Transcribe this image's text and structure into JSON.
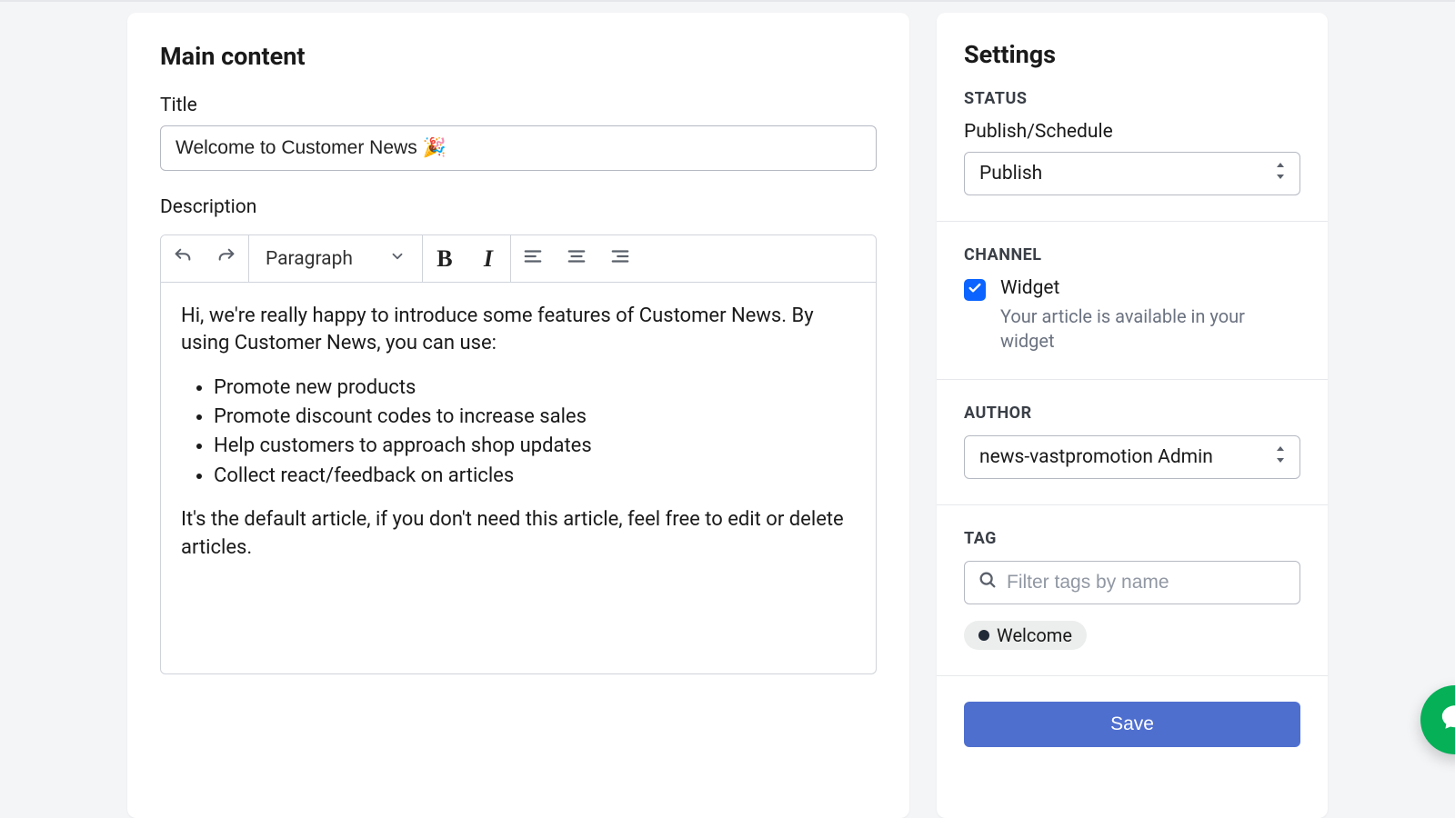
{
  "main": {
    "card_title": "Main content",
    "title_label": "Title",
    "title_value": "Welcome to Customer News 🎉",
    "description_label": "Description",
    "toolbar": {
      "style_label": "Paragraph"
    },
    "content": {
      "intro": "Hi, we're really happy to introduce some features of Customer News. By using Customer News, you can use:",
      "bullets": [
        "Promote new products",
        "Promote discount codes to increase sales",
        "Help customers to approach shop updates",
        "Collect react/feedback on articles"
      ],
      "outro": "It's the default article, if you don't need this article, feel free to edit or delete articles."
    }
  },
  "settings": {
    "title": "Settings",
    "status": {
      "heading": "STATUS",
      "label": "Publish/Schedule",
      "value": "Publish"
    },
    "channel": {
      "heading": "CHANNEL",
      "widget_label": "Widget",
      "widget_desc": "Your article is available in your widget"
    },
    "author": {
      "heading": "AUTHOR",
      "value": "news-vastpromotion Admin"
    },
    "tag": {
      "heading": "TAG",
      "placeholder": "Filter tags by name",
      "tags": [
        "Welcome"
      ]
    },
    "save_label": "Save"
  }
}
